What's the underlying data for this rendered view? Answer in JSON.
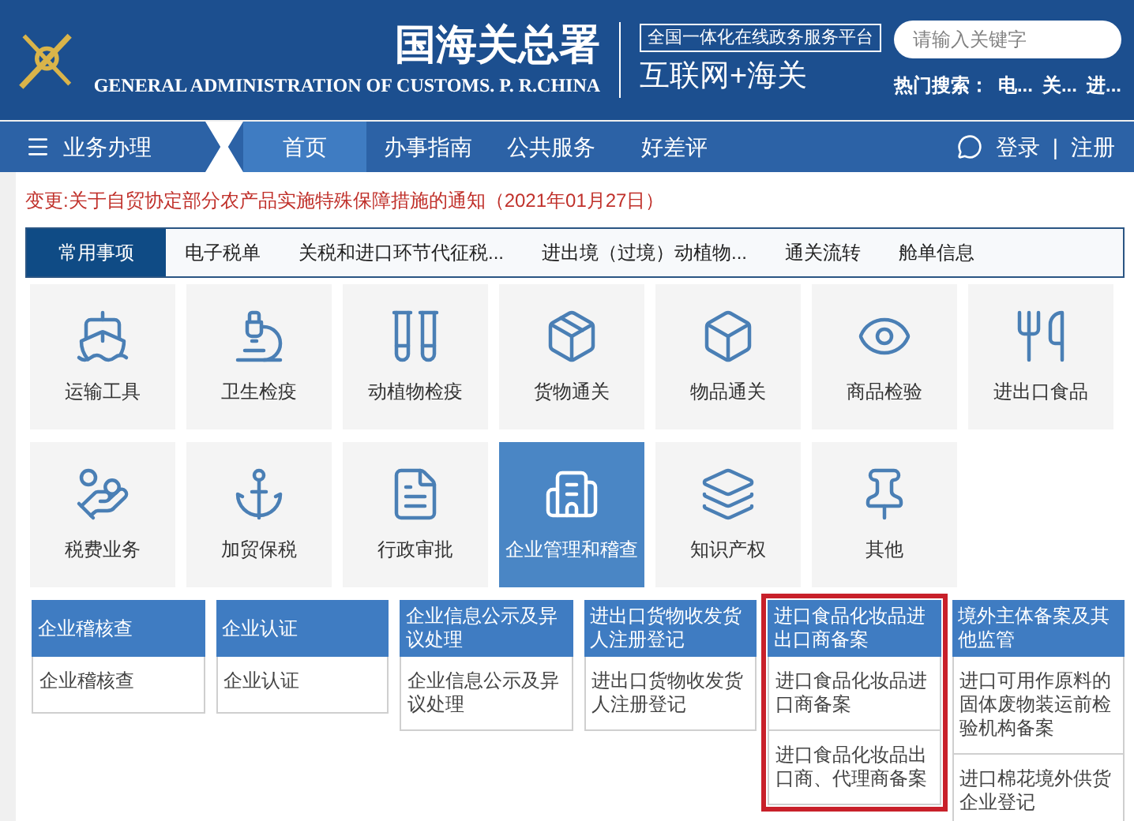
{
  "header": {
    "title": "国海关总署",
    "subtitle": "GENERAL ADMINISTRATION OF CUSTOMS. P. R.CHINA",
    "platform_tag": "全国一体化在线政务服务平台",
    "platform_name": "互联网+海关",
    "search": {
      "placeholder": "请输入关键字"
    },
    "hot_search": {
      "label": "热门搜索：",
      "items": [
        "电...",
        "关...",
        "进..."
      ]
    }
  },
  "nav": {
    "menu": "业务办理",
    "items": [
      {
        "label": "首页",
        "selected": true
      },
      {
        "label": "办事指南",
        "selected": false
      },
      {
        "label": "公共服务",
        "selected": false
      },
      {
        "label": "好差评",
        "selected": false
      }
    ],
    "login": "登录",
    "separator": "|",
    "register": "注册"
  },
  "notice": "变更:关于自贸协定部分农产品实施特殊保障措施的通知（2021年01月27日）",
  "tabs": [
    {
      "label": "常用事项",
      "selected": true
    },
    {
      "label": "电子税单",
      "selected": false
    },
    {
      "label": "关税和进口环节代征税...",
      "selected": false
    },
    {
      "label": "进出境（过境）动植物...",
      "selected": false
    },
    {
      "label": "通关流转",
      "selected": false
    },
    {
      "label": "舱单信息",
      "selected": false
    }
  ],
  "tiles": [
    {
      "label": "运输工具",
      "selected": false
    },
    {
      "label": "卫生检疫",
      "selected": false
    },
    {
      "label": "动植物检疫",
      "selected": false
    },
    {
      "label": "货物通关",
      "selected": false
    },
    {
      "label": "物品通关",
      "selected": false
    },
    {
      "label": "商品检验",
      "selected": false
    },
    {
      "label": "进出口食品",
      "selected": false
    },
    {
      "label": "税费业务",
      "selected": false
    },
    {
      "label": "加贸保税",
      "selected": false
    },
    {
      "label": "行政审批",
      "selected": false
    },
    {
      "label": "企业管理和稽查",
      "selected": true
    },
    {
      "label": "知识产权",
      "selected": false
    },
    {
      "label": "其他",
      "selected": false
    }
  ],
  "panels": [
    {
      "title": "企业稽核查",
      "highlighted": false,
      "items": [
        "企业稽核查"
      ]
    },
    {
      "title": "企业认证",
      "highlighted": false,
      "items": [
        "企业认证"
      ]
    },
    {
      "title": "企业信息公示及异议处理",
      "highlighted": false,
      "items": [
        "企业信息公示及异议处理"
      ]
    },
    {
      "title": "进出口货物收发货人注册登记",
      "highlighted": false,
      "items": [
        "进出口货物收发货人注册登记"
      ]
    },
    {
      "title": "进口食品化妆品进出口商备案",
      "highlighted": true,
      "items": [
        "进口食品化妆品进口商备案",
        "进口食品化妆品出口商、代理商备案"
      ]
    },
    {
      "title": "境外主体备案及其他监管",
      "highlighted": false,
      "items": [
        "进口可用作原料的固体废物装运前检验机构备案",
        "进口棉花境外供货企业登记"
      ]
    }
  ]
}
